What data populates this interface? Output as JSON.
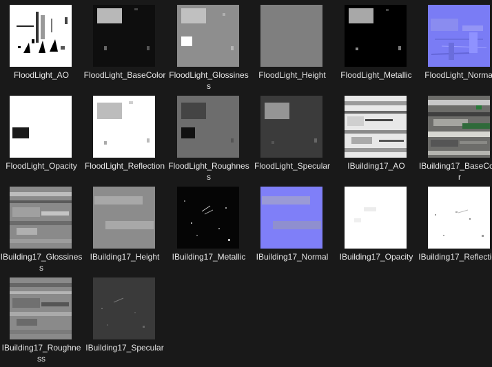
{
  "files": [
    {
      "name": "FloodLight_AO",
      "icon": "ao-texture-icon"
    },
    {
      "name": "FloodLight_BaseColor",
      "icon": "basecolor-texture-icon"
    },
    {
      "name": "FloodLight_Glossiness",
      "icon": "glossiness-texture-icon"
    },
    {
      "name": "FloodLight_Height",
      "icon": "height-texture-icon"
    },
    {
      "name": "FloodLight_Metallic",
      "icon": "metallic-texture-icon"
    },
    {
      "name": "FloodLight_Normal",
      "icon": "normal-texture-icon"
    },
    {
      "name": "FloodLight_Opacity",
      "icon": "opacity-texture-icon"
    },
    {
      "name": "FloodLight_Reflection",
      "icon": "reflection-texture-icon"
    },
    {
      "name": "FloodLight_Roughness",
      "icon": "roughness-texture-icon"
    },
    {
      "name": "FloodLight_Specular",
      "icon": "specular-texture-icon"
    },
    {
      "name": "IBuilding17_AO",
      "icon": "ao-texture-icon"
    },
    {
      "name": "IBuilding17_BaseColor",
      "icon": "basecolor-texture-icon"
    },
    {
      "name": "IBuilding17_Glossiness",
      "icon": "glossiness-texture-icon"
    },
    {
      "name": "IBuilding17_Height",
      "icon": "height-texture-icon"
    },
    {
      "name": "IBuilding17_Metallic",
      "icon": "metallic-texture-icon"
    },
    {
      "name": "IBuilding17_Normal",
      "icon": "normal-texture-icon"
    },
    {
      "name": "IBuilding17_Opacity",
      "icon": "opacity-texture-icon"
    },
    {
      "name": "IBuilding17_Reflection",
      "icon": "reflection-texture-icon"
    },
    {
      "name": "IBuilding17_Roughness",
      "icon": "roughness-texture-icon"
    },
    {
      "name": "IBuilding17_Specular",
      "icon": "specular-texture-icon"
    }
  ],
  "colors": {
    "background": "#191919",
    "label_text": "#e6e6e6"
  }
}
